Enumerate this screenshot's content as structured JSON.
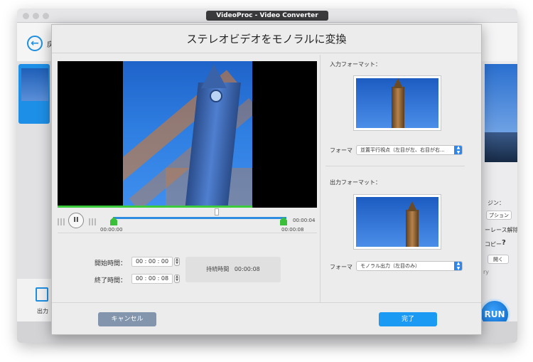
{
  "app": {
    "title": "VideoProc - Video Converter",
    "back_label": "戻",
    "output_label": "出力",
    "right_panel": {
      "option_header": "ジン：",
      "option_button": "プション",
      "interlace": "ーレース解除",
      "copy_label": "コピー",
      "help_icon": "?",
      "open_button": "開く",
      "small_text": "ry"
    },
    "run_label": "RUN"
  },
  "dialog": {
    "title": "ステレオビデオをモノラルに変換",
    "timeline": {
      "current_time": "00:00:04",
      "start_label": "00:00:00",
      "end_label": "00:00:08",
      "progress_fraction": 0.6
    },
    "start_time": {
      "label": "開始時間：",
      "value": "00 : 00 : 00"
    },
    "end_time": {
      "label": "終了時間：",
      "value": "00 : 00 : 08"
    },
    "duration": {
      "label": "持続時間",
      "value": "00:00:08"
    },
    "input": {
      "section_label": "入力フォーマット：",
      "format_label": "フォーマ",
      "format_value": "並置平行視点（左目が左、右目が右..."
    },
    "output": {
      "section_label": "出力フォーマット：",
      "format_label": "フォーマ",
      "format_value": "モノラル出力（左目のみ）"
    },
    "cancel_label": "キャンセル",
    "done_label": "完了"
  },
  "colors": {
    "accent": "#1a9af2",
    "cancel": "#8295ad",
    "timeline_track": "#2e8de0",
    "trim_handle": "#3bbf3b"
  }
}
